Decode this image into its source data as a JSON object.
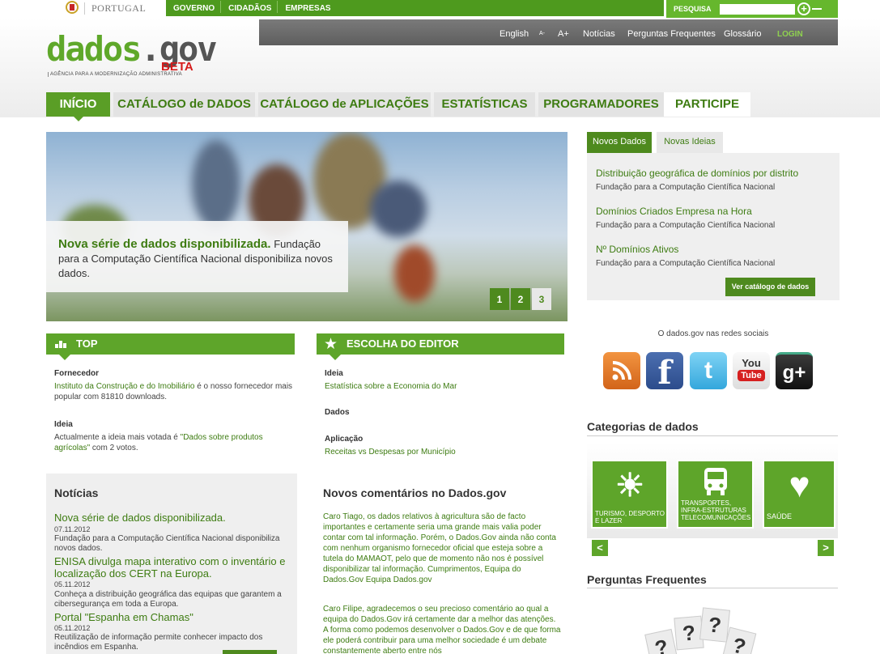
{
  "topbar": {
    "country": "PORTUGAL",
    "nav": [
      "GOVERNO",
      "CIDADÃOS",
      "EMPRESAS"
    ],
    "search_label": "PESQUISA",
    "search_value": ""
  },
  "header": {
    "utility": [
      "English",
      "A-",
      "A+",
      "Notícias",
      "Perguntas Frequentes",
      "Glossário",
      "LOGIN"
    ],
    "logo_dados": "dados",
    "logo_dot": ".",
    "logo_gov": "gov",
    "logo_beta": "BETA",
    "logo_sub": "AGÊNCIA PARA A MODERNIZAÇÃO ADMINISTRATIVA"
  },
  "mainnav": [
    "INÍCIO",
    "CATÁLOGO de DADOS",
    "CATÁLOGO de APLICAÇÕES",
    "ESTATÍSTICAS",
    "PROGRAMADORES",
    "PARTICIPE"
  ],
  "hero": {
    "title": "Nova série de dados disponibilizada.",
    "text": "Fundação para a Computação Científica Nacional disponibiliza novos dados.",
    "pages": [
      "1",
      "2",
      "3"
    ],
    "active_page": "3"
  },
  "right_tabs": {
    "tabs": [
      "Novos Dados",
      "Novas Ideias"
    ],
    "items": [
      {
        "title": "Distribuição geográfica de domínios por distrito",
        "sub": "Fundação para a Computação Científica Nacional"
      },
      {
        "title": "Domínios Criados Empresa na Hora",
        "sub": "Fundação para a Computação Científica Nacional"
      },
      {
        "title": "Nº Domínios Ativos",
        "sub": "Fundação para a Computação Científica Nacional"
      }
    ],
    "button": "Ver catálogo de dados"
  },
  "social": {
    "title": "O dados.gov nas redes sociais",
    "icons": [
      "rss-icon",
      "facebook-icon",
      "twitter-icon",
      "youtube-icon",
      "google-plus-icon"
    ]
  },
  "top": {
    "heading": "TOP",
    "l1": "Fornecedor",
    "link1": "Instituto da Construção e do Imobiliário",
    "t1": " é o nosso fornecedor mais popular com 81810 downloads.",
    "l2": "Ideia",
    "t2a": "Actualmente a ideia mais votada é ",
    "link2": "\"Dados sobre produtos agrícolas\"",
    "t2b": " com 2 votos."
  },
  "editor": {
    "heading": "ESCOLHA DO EDITOR",
    "l1": "Ideia",
    "v1": "Estatística sobre a Economia do Mar",
    "l2": "Dados",
    "l3": "Aplicação",
    "v3": "Receitas vs Despesas por Município"
  },
  "categories": {
    "title": "Categorias de dados",
    "cards": [
      "TURISMO, DESPORTO E LAZER",
      "TRANSPORTES, INFRA-ESTRUTURAS TELECOMUNICAÇÕES",
      "SAÚDE"
    ],
    "prev": "<",
    "next": ">"
  },
  "faq": {
    "title": "Perguntas Frequentes"
  },
  "news": {
    "title": "Notícias",
    "items": [
      {
        "title": "Nova série de dados disponibilizada.",
        "date": "07.11.2012",
        "text": "Fundação para a Computação Científica Nacional disponibiliza novos dados."
      },
      {
        "title": "ENISA divulga mapa interativo com o inventário e localização dos CERT na Europa.",
        "date": "05.11.2012",
        "text": "Conheça a distribuição geográfica das equipas que garantem a cibersegurança em toda a Europa."
      },
      {
        "title": "Portal \"Espanha em Chamas\"",
        "date": "05.11.2012",
        "text": "Reutilização de informação permite conhecer impacto dos incêndios em Espanha."
      }
    ]
  },
  "comments": {
    "title": "Novos comentários no Dados.gov",
    "c1": "Caro Tiago, os dados relativos à agricultura são de facto importantes e certamente seria uma grande mais valia poder contar com tal informação. Porém, o Dados.Gov ainda não conta com nenhum organismo fornecedor oficial que esteja sobre a tutela do MAMAOT, pelo que de momento não nos é possível disponibilizar tal informação. Cumprimentos, Equipa do Dados.Gov Equipa Dados.gov",
    "c2": "Caro Filipe, agradecemos o seu precioso comentário ao qual a equipa do Dados.Gov irá certamente dar a melhor das atenções. A forma como podemos desenvolver o Dados.Gov e de que forma ele poderá contribuir para uma melhor sociedade é um debate constantemente aberto entre nós"
  }
}
